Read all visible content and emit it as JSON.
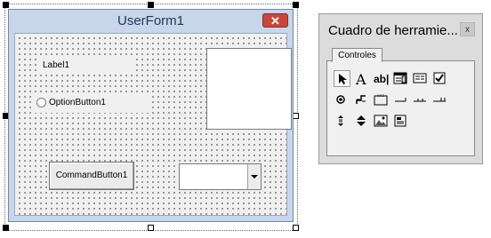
{
  "userform": {
    "title": "UserForm1",
    "close_glyph": "✕",
    "label_text": "Label1",
    "option_text": "OptionButton1",
    "command_text": "CommandButton1",
    "frame_caption": "",
    "combo_value": ""
  },
  "toolbox": {
    "title": "Cuadro de herramie...",
    "close_glyph": "x",
    "tab_label": "Controles",
    "tools": [
      {
        "name": "select-objects-tool",
        "icon": "pointer-arrow",
        "selected": true
      },
      {
        "name": "label-tool",
        "icon": "letter-a"
      },
      {
        "name": "textbox-tool",
        "icon": "ab-text"
      },
      {
        "name": "combobox-tool",
        "icon": "combo-list"
      },
      {
        "name": "listbox-tool",
        "icon": "list-box"
      },
      {
        "name": "checkbox-tool",
        "icon": "checkmark"
      },
      {
        "name": "optionbutton-tool",
        "icon": "radio-dot"
      },
      {
        "name": "togglebutton-tool",
        "icon": "toggle-steps"
      },
      {
        "name": "frame-tool",
        "icon": "frame-xyz"
      },
      {
        "name": "commandbutton-tool",
        "icon": "button-rect"
      },
      {
        "name": "tabstrip-tool",
        "icon": "tab-strip"
      },
      {
        "name": "multipage-tool",
        "icon": "multi-page"
      },
      {
        "name": "scrollbar-tool",
        "icon": "scroll-arrows"
      },
      {
        "name": "spinbutton-tool",
        "icon": "spin-arrows"
      },
      {
        "name": "image-tool",
        "icon": "picture"
      },
      {
        "name": "refedit-tool",
        "icon": "ref-edit"
      }
    ],
    "tool_label_sample": "XYZ"
  }
}
